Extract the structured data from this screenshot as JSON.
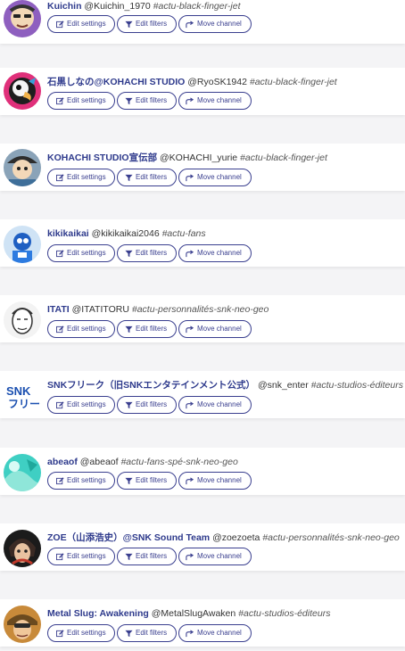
{
  "buttons": {
    "edit_settings": "Edit settings",
    "edit_filters": "Edit filters",
    "move_channel": "Move channel"
  },
  "colors": {
    "name": "#2e3a8c",
    "button_border": "#3a3f8f",
    "background": "#f4f4f6"
  },
  "icons": {
    "edit_settings": "edit-square-pencil-icon",
    "edit_filters": "funnel-filter-icon",
    "move_channel": "share-arrow-icon"
  },
  "feeds": [
    {
      "name": "Kuichin",
      "handle": "@Kuichin_1970",
      "channel": "#actu-black-finger-jet",
      "avatar": "cartoon-man-purple"
    },
    {
      "name": "石黒しなの@KOHACHI STUDIO",
      "handle": "@RyoSK1942",
      "channel": "#actu-black-finger-jet",
      "avatar": "parrot-pink"
    },
    {
      "name": "KOHACHI STUDIO宣伝部",
      "handle": "@KOHACHI_yurie",
      "channel": "#actu-black-finger-jet",
      "avatar": "character-with-hat"
    },
    {
      "name": "kikikaikai",
      "handle": "@kikikaikai2046",
      "channel": "#actu-fans",
      "avatar": "blue-anime-character"
    },
    {
      "name": "ITATI",
      "handle": "@ITATITORU",
      "channel": "#actu-personnalités-snk-neo-geo",
      "avatar": "sketch-face"
    },
    {
      "name": "SNKフリーク（旧SNKエンタテインメント公式）",
      "handle": "@snk_enter",
      "channel": "#actu-studios-éditeurs",
      "avatar": "snk-logo"
    },
    {
      "name": "abeaof",
      "handle": "@abeaof",
      "channel": "#actu-fans-spé-snk-neo-geo",
      "avatar": "teal-abstract"
    },
    {
      "name": "ZOE（山添浩史）@SNK Sound Team",
      "handle": "@zoezoeta",
      "channel": "#actu-personnalités-snk-neo-geo",
      "avatar": "dark-hair-character"
    },
    {
      "name": "Metal Slug: Awakening",
      "handle": "@MetalSlugAwaken",
      "channel": "#actu-studios-éditeurs",
      "avatar": "metal-slug-soldier"
    }
  ]
}
